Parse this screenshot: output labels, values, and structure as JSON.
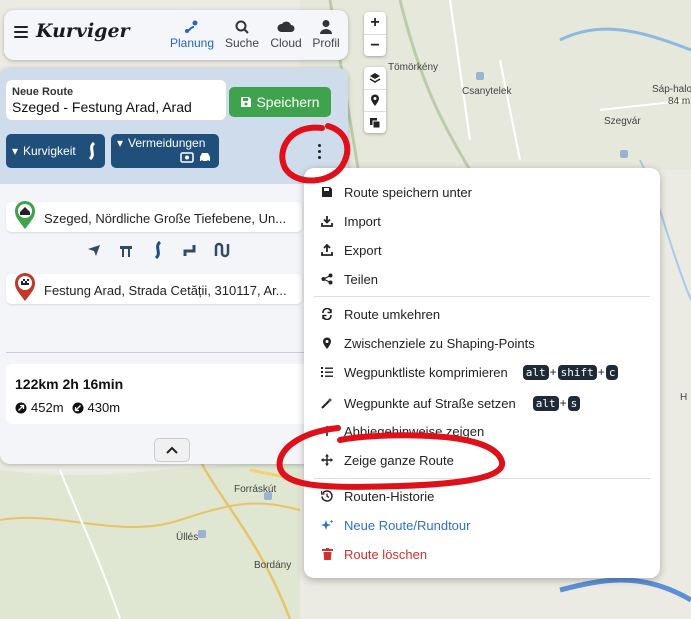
{
  "app": {
    "logo": "Kurviger",
    "nav": [
      {
        "label": "Planung",
        "icon": "route-icon",
        "active": true
      },
      {
        "label": "Suche",
        "icon": "search-icon",
        "active": false
      },
      {
        "label": "Cloud",
        "icon": "cloud-icon",
        "active": false
      },
      {
        "label": "Profil",
        "icon": "user-icon",
        "active": false
      }
    ]
  },
  "route": {
    "label": "Neue Route",
    "name": "Szeged - Festung Arad, Arad",
    "save_label": "Speichern",
    "chips": {
      "curviness": "Kurvigkeit",
      "avoid": "Vermeidungen"
    }
  },
  "waypoints": [
    {
      "text": "Szeged, Nördliche Große Tiefebene, Un...",
      "icon": "home-pin-icon"
    },
    {
      "text": "Festung Arad, Strada Cetății, 310117, Ar...",
      "icon": "finish-pin-icon"
    }
  ],
  "stats": {
    "distance_duration": "122km  2h 16min",
    "ascent": "452m",
    "descent": "430m"
  },
  "map_labels": [
    {
      "text": "Tömörkény"
    },
    {
      "text": "Csanytelek"
    },
    {
      "text": "Sáp-halo"
    },
    {
      "text": "84 m"
    },
    {
      "text": "Szegvár"
    },
    {
      "text": "Forráskút"
    },
    {
      "text": "Üllés"
    },
    {
      "text": "Bordány"
    },
    {
      "text": "H"
    }
  ],
  "menu": {
    "items": [
      {
        "label": "Route speichern unter",
        "icon": "save-icon"
      },
      {
        "label": "Import",
        "icon": "download-icon"
      },
      {
        "label": "Export",
        "icon": "upload-icon"
      },
      {
        "label": "Teilen",
        "icon": "share-icon"
      },
      {
        "label": "Route umkehren",
        "icon": "reverse-icon"
      },
      {
        "label": "Zwischenziele zu Shaping-Points",
        "icon": "pin-icon"
      },
      {
        "label": "Wegpunktliste komprimieren",
        "icon": "list-icon",
        "shortcut": [
          "alt",
          "shift",
          "c"
        ]
      },
      {
        "label": "Wegpunkte auf Straße setzen",
        "icon": "magic-wand-icon",
        "shortcut": [
          "alt",
          "s"
        ]
      },
      {
        "label": "Abbiegehinweise zeigen",
        "icon": "turn-signs-icon"
      },
      {
        "label": "Zeige ganze Route",
        "icon": "move-arrows-icon"
      },
      {
        "label": "Routen-Historie",
        "icon": "history-icon"
      },
      {
        "label": "Neue Route/Rundtour",
        "icon": "sparkle-icon",
        "color": "#2e6fd0"
      },
      {
        "label": "Route löschen",
        "icon": "trash-icon",
        "color": "#d33030"
      }
    ]
  },
  "colors": {
    "accent": "#2563c9",
    "save": "#3fa34d",
    "chip": "#1f4f7a",
    "annotation": "#e0101a"
  }
}
